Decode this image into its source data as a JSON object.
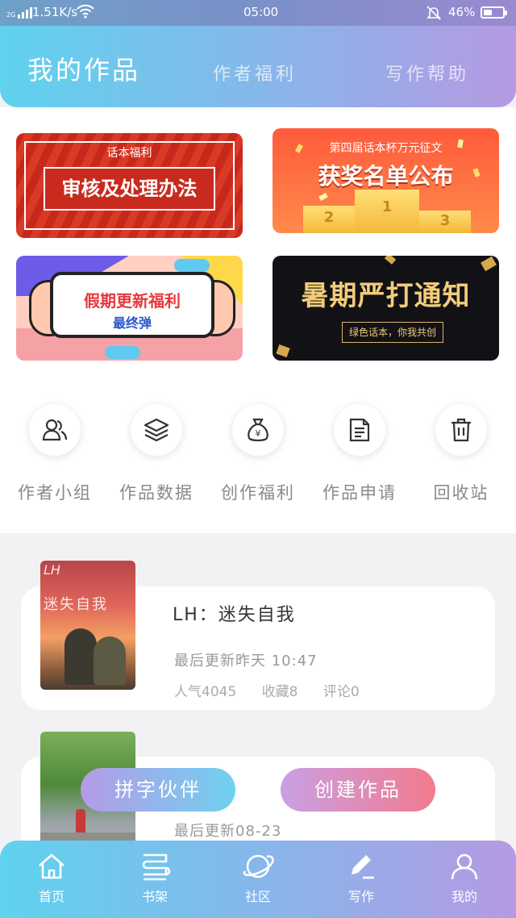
{
  "status_bar": {
    "network_type": "2G",
    "speed": "1.51K/s",
    "time": "05:00",
    "battery": "46%",
    "battery_level": 0.46
  },
  "header": {
    "tabs": [
      {
        "label": "我的作品",
        "active": true
      },
      {
        "label": "作者福利",
        "active": false
      },
      {
        "label": "写作帮助",
        "active": false
      }
    ]
  },
  "banners": [
    {
      "subtitle": "话本福利",
      "title": "审核及处理办法"
    },
    {
      "subtitle": "第四届话本杯万元征文",
      "title": "获奖名单公布",
      "podium": [
        "2",
        "1",
        "3"
      ]
    },
    {
      "title": "假期更新福利",
      "subtitle": "最终弹"
    },
    {
      "title": "暑期严打通知",
      "subtitle": "绿色话本，你我共创"
    }
  ],
  "shortcuts": [
    {
      "label": "作者小组",
      "icon": "group-icon"
    },
    {
      "label": "作品数据",
      "icon": "layers-icon"
    },
    {
      "label": "创作福利",
      "icon": "money-bag-icon"
    },
    {
      "label": "作品申请",
      "icon": "document-icon"
    },
    {
      "label": "回收站",
      "icon": "trash-icon"
    }
  ],
  "works": [
    {
      "title": "LH：迷失自我",
      "cover_text": "迷失自我",
      "cover_mark": "LH",
      "updated": "最后更新昨天 10:47",
      "popularity": "人气4045",
      "favorites": "收藏8",
      "comments": "评论0"
    },
    {
      "updated": "最后更新08-23"
    }
  ],
  "actions": {
    "partner": "拼字伙伴",
    "create": "创建作品"
  },
  "bottom_nav": [
    {
      "label": "首页",
      "icon": "home-icon"
    },
    {
      "label": "书架",
      "icon": "bookshelf-icon"
    },
    {
      "label": "社区",
      "icon": "planet-icon"
    },
    {
      "label": "写作",
      "icon": "pen-icon",
      "active": true
    },
    {
      "label": "我的",
      "icon": "profile-icon"
    }
  ],
  "colors": {
    "header_start": "#5fd2ee",
    "header_end": "#b59ae3",
    "create_button": "#f27a8e"
  }
}
